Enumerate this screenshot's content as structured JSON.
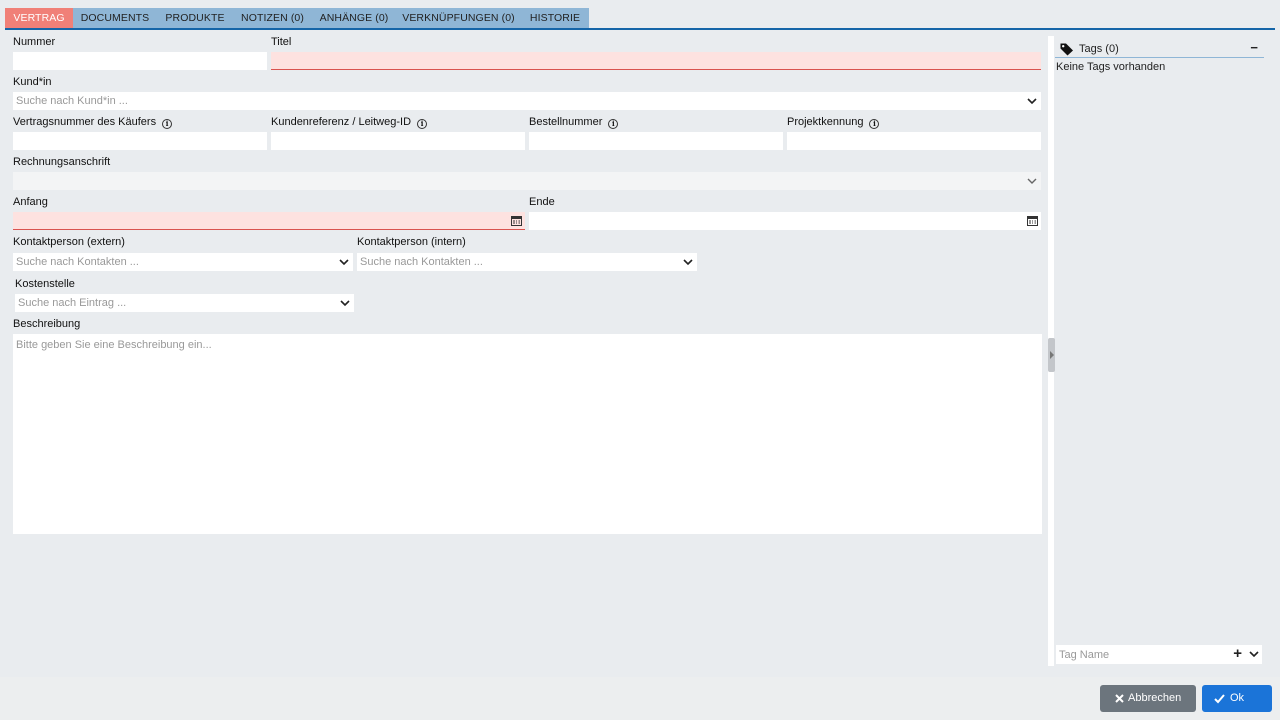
{
  "tabs": [
    {
      "label": "VERTRAG",
      "active": true
    },
    {
      "label": "DOCUMENTS",
      "active": false
    },
    {
      "label": "PRODUKTE",
      "active": false
    },
    {
      "label": "NOTIZEN (0)",
      "active": false
    },
    {
      "label": "ANHÄNGE (0)",
      "active": false
    },
    {
      "label": "VERKNÜPFUNGEN (0)",
      "active": false
    },
    {
      "label": "HISTORIE",
      "active": false
    }
  ],
  "form": {
    "nummer_label": "Nummer",
    "titel_label": "Titel",
    "kunde_label": "Kund*in",
    "kunde_placeholder": "Suche nach Kund*in ...",
    "vertragsnummer_label": "Vertragsnummer des Käufers",
    "kundenreferenz_label": "Kundenreferenz / Leitweg-ID",
    "bestellnummer_label": "Bestellnummer",
    "projektkennung_label": "Projektkennung",
    "rechnungsanschrift_label": "Rechnungsanschrift",
    "anfang_label": "Anfang",
    "ende_label": "Ende",
    "kontakt_extern_label": "Kontaktperson (extern)",
    "kontakt_extern_placeholder": "Suche nach Kontakten ...",
    "kontakt_intern_label": "Kontaktperson (intern)",
    "kontakt_intern_placeholder": "Suche nach Kontakten ...",
    "kostenstelle_label": "Kostenstelle",
    "kostenstelle_placeholder": "Suche nach Eintrag ...",
    "beschreibung_label": "Beschreibung",
    "beschreibung_placeholder": "Bitte geben Sie eine Beschreibung ein...",
    "info_glyph": "i"
  },
  "tags": {
    "title": "Tags (0)",
    "collapse_glyph": "−",
    "empty_text": "Keine Tags vorhanden",
    "input_placeholder": "Tag Name",
    "add_glyph": "+"
  },
  "footer": {
    "cancel_label": "Abbrechen",
    "ok_label": "Ok"
  },
  "colors": {
    "active_tab": "#f08078",
    "tab": "#8fb6d6",
    "tab_underline": "#1565a8",
    "invalid_field": "#fde2e0",
    "cancel_button": "#6c757d",
    "ok_button": "#1b74d8"
  }
}
